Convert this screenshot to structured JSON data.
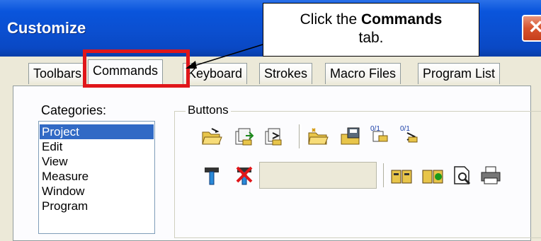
{
  "window": {
    "title": "Customize",
    "close_label": "✕"
  },
  "callout": {
    "prefix": "Click the ",
    "bold": "Commands",
    "suffix": "tab."
  },
  "tabs": [
    {
      "label": "Toolbars"
    },
    {
      "label": "Commands"
    },
    {
      "label": "Keyboard"
    },
    {
      "label": "Strokes"
    },
    {
      "label": "Macro Files"
    },
    {
      "label": "Program List"
    }
  ],
  "categories": {
    "label": "Categories:",
    "items": [
      "Project",
      "Edit",
      "View",
      "Measure",
      "Window",
      "Program"
    ],
    "selected": "Project"
  },
  "buttons": {
    "label": "Buttons",
    "icons": [
      "open-project-icon",
      "import-icon",
      "export-icon",
      "open-folder-icon",
      "save-folder-icon",
      "load-data-icon",
      "save-data-icon",
      "hammer-icon",
      "delete-icon",
      "open-book-icon",
      "close-book-icon",
      "print-preview-icon",
      "print-icon"
    ]
  },
  "colors": {
    "highlight": "#e0161a",
    "title_bar": "#0a55dc",
    "selection": "#316ac5"
  }
}
